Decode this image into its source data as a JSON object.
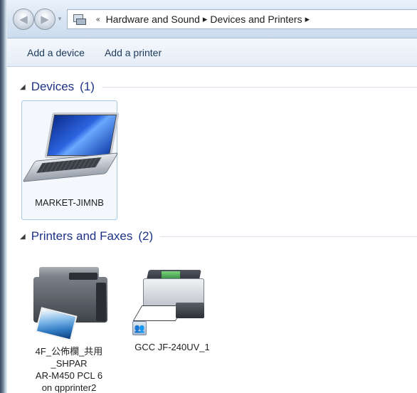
{
  "address_bar": {
    "back_icon": "back-arrow-icon",
    "forward_icon": "forward-arrow-icon",
    "overflow": "«",
    "breadcrumbs": [
      "Hardware and Sound",
      "Devices and Printers"
    ]
  },
  "commands": {
    "add_device": "Add a device",
    "add_printer": "Add a printer"
  },
  "groups": {
    "devices": {
      "title": "Devices",
      "count": "(1)",
      "items": [
        {
          "label": "MARKET-JIMNB",
          "icon": "laptop-icon",
          "selected": true
        }
      ]
    },
    "printers": {
      "title": "Printers and Faxes",
      "count": "(2)",
      "items": [
        {
          "label_lines": [
            "4F_公佈欄_共用",
            "_SHPAR",
            "AR-M450 PCL 6",
            "on qpprinter2"
          ],
          "icon": "multifunction-printer-icon"
        },
        {
          "label": "GCC JF-240UV_1",
          "icon": "printer-icon",
          "shared": true
        }
      ]
    }
  },
  "colors": {
    "group_header": "#1e3287",
    "command_text": "#1e395b",
    "selection_border": "#a8c6e6"
  }
}
